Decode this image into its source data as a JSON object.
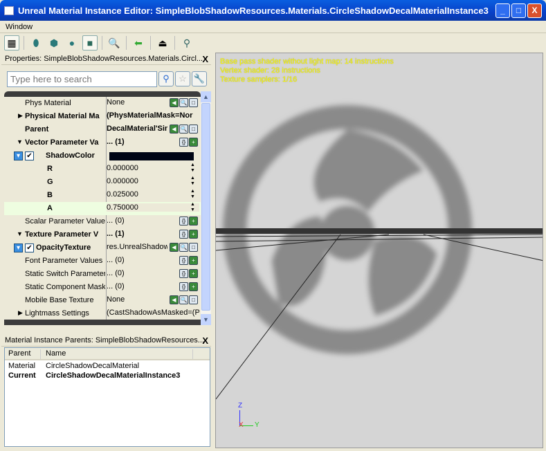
{
  "window": {
    "title": "Unreal Material Instance Editor: SimpleBlobShadowResources.Materials.CircleShadowDecalMaterialInstance3",
    "minimize": "_",
    "maximize": "□",
    "close": "X"
  },
  "menu": {
    "items": [
      "Window"
    ]
  },
  "toolbar": {
    "buttons": [
      "grid-icon",
      "cylinder-icon",
      "cube-icon",
      "sphere-icon",
      "plane-icon",
      "find-in-browser-icon",
      "back-arrow-icon",
      "realtime-icon",
      "show-flags-icon"
    ]
  },
  "properties": {
    "title": "Properties: SimpleBlobShadowResources.Materials.Circl...",
    "close": "X",
    "search_placeholder": "Type here to search",
    "rows": [
      {
        "name": "Phys Material",
        "value": "None"
      },
      {
        "name": "Physical Material Ma",
        "value": "(PhysMaterialMask=Nor"
      },
      {
        "name": "Parent",
        "value": "DecalMaterial'Simpl"
      },
      {
        "name": "Vector Parameter Va",
        "value": "... (1)"
      },
      {
        "name": "ShadowColor",
        "value": ""
      },
      {
        "name": "R",
        "value": "0.000000"
      },
      {
        "name": "G",
        "value": "0.000000"
      },
      {
        "name": "B",
        "value": "0.025000"
      },
      {
        "name": "A",
        "value": "0.750000"
      },
      {
        "name": "Scalar Parameter Values",
        "value": "... (0)"
      },
      {
        "name": "Texture Parameter V",
        "value": "... (1)"
      },
      {
        "name": "OpacityTexture",
        "value": "res.UnrealShadow"
      },
      {
        "name": "Font Parameter Values",
        "value": "... (0)"
      },
      {
        "name": "Static Switch Parameter",
        "value": "... (0)"
      },
      {
        "name": "Static Component Mask",
        "value": "... (0)"
      },
      {
        "name": "Mobile Base Texture",
        "value": "None"
      },
      {
        "name": "Lightmass Settings",
        "value": "(CastShadowAsMasked=(Pa"
      }
    ],
    "shadow_color": "#000516"
  },
  "parents": {
    "title": "Material Instance Parents: SimpleBlobShadowResources...",
    "close": "X",
    "columns": [
      "Parent",
      "Name"
    ],
    "rows": [
      [
        "Material",
        "CircleShadowDecalMaterial"
      ],
      [
        "Current",
        "CircleShadowDecalMaterialInstance3"
      ]
    ]
  },
  "viewport": {
    "stats": [
      "Base pass shader without light map: 14 instructions",
      "Vertex shader: 28 instructions",
      "Texture samplers: 1/16"
    ],
    "axes": {
      "z": "Z",
      "x": "X",
      "y": "Y"
    }
  }
}
